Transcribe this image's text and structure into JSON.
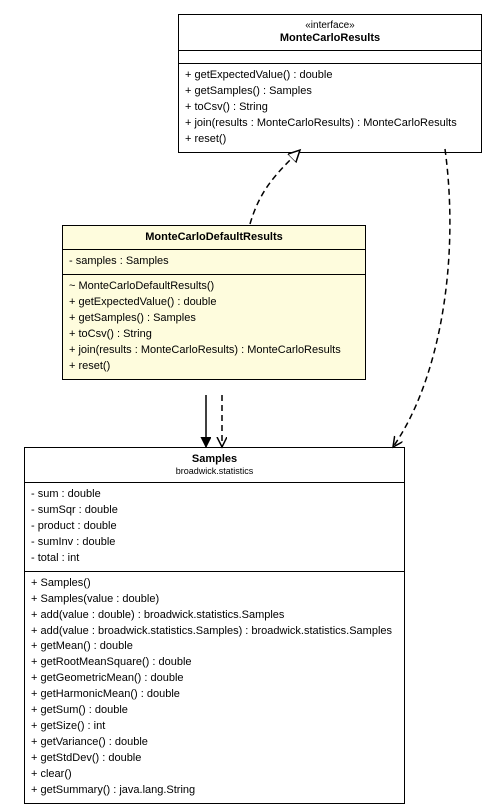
{
  "interface": {
    "stereotype": "«interface»",
    "name": "MonteCarloResults",
    "ops": [
      "+ getExpectedValue() : double",
      "+ getSamples() : Samples",
      "+ toCsv() : String",
      "+ join(results : MonteCarloResults) : MonteCarloResults",
      "+ reset()"
    ]
  },
  "defaults": {
    "name": "MonteCarloDefaultResults",
    "attrs": [
      "- samples : Samples"
    ],
    "ops": [
      "~ MonteCarloDefaultResults()",
      "+ getExpectedValue() : double",
      "+ getSamples() : Samples",
      "+ toCsv() : String",
      "+ join(results : MonteCarloResults) : MonteCarloResults",
      "+ reset()"
    ]
  },
  "samples": {
    "name": "Samples",
    "package": "broadwick.statistics",
    "attrs": [
      "- sum : double",
      "- sumSqr : double",
      "- product : double",
      "- sumInv : double",
      "- total : int"
    ],
    "ops": [
      "+ Samples()",
      "+ Samples(value : double)",
      "+ add(value : double) : broadwick.statistics.Samples",
      "+ add(value : broadwick.statistics.Samples) : broadwick.statistics.Samples",
      "+ getMean() : double",
      "+ getRootMeanSquare() : double",
      "+ getGeometricMean() : double",
      "+ getHarmonicMean() : double",
      "+ getSum() : double",
      "+ getSize() : int",
      "+ getVariance() : double",
      "+ getStdDev() : double",
      "+ clear()",
      "+ getSummary() : java.lang.String"
    ]
  }
}
